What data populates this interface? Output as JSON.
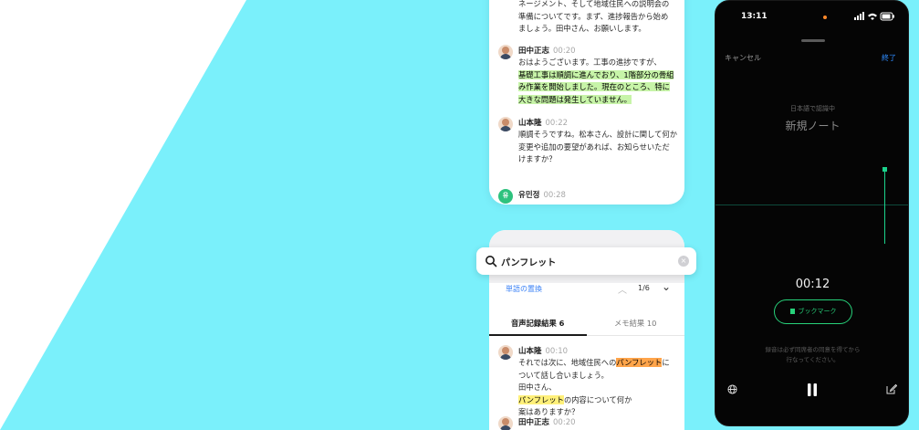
{
  "colors": {
    "accent_cyan": "#7af0fb",
    "highlight_green": "#c7f4a8",
    "highlight_orange": "#ffa44a",
    "highlight_yellow": "#fff07a",
    "record_green": "#27d17a",
    "link_blue": "#3b82f6"
  },
  "transcript": {
    "intro": {
      "lines": [
        "ネージメント、そして地域住民への説明会の",
        "準備についてです。まず、進捗報告から始め",
        "ましょう。田中さん、お願いします。"
      ]
    },
    "messages": [
      {
        "name": "田中正志",
        "time": "00:20",
        "lines": [
          {
            "text": "おはようございます。工事の進捗ですが、",
            "hl": ""
          },
          {
            "text": "基礎工事は順調に進んでおり、1階部分の骨組",
            "hl": "green"
          },
          {
            "text": "み作業を開始しました。現在のところ、特に",
            "hl": "green"
          },
          {
            "text": "大きな問題は発生していません。",
            "hl": "green"
          }
        ]
      },
      {
        "name": "山本隆",
        "time": "00:22",
        "lines": [
          {
            "text": "順調そうですね。松本さん、設計に関して何か",
            "hl": ""
          },
          {
            "text": "変更や追加の要望があれば、お知らせいただ",
            "hl": ""
          },
          {
            "text": "けますか？",
            "hl": ""
          }
        ]
      },
      {
        "name": "유민정",
        "time": "00:28",
        "avatar_letter": "유"
      }
    ]
  },
  "search": {
    "query": "パンフレット",
    "replace_label": "単語の置換",
    "count": "1/6",
    "tab_transcript": "音声記録結果 6",
    "tab_memo": "メモ結果 10",
    "result": {
      "name": "山本隆",
      "time": "00:10",
      "line1_a": "それでは次に、地域住民への",
      "line1_hl": "パンフレット",
      "line1_b": "に",
      "line2": "ついて話し合いましょう。",
      "line3": "田中さん、",
      "line4_hl": "パンフレット",
      "line4_b": "の内容について何か",
      "line5": "案はありますか？"
    },
    "next": {
      "name": "田中正志",
      "time": "00:20"
    }
  },
  "phone": {
    "status_time": "13:11",
    "cancel_label": "キャンセル",
    "done_label": "終了",
    "lang_status": "日本語で認識中",
    "note_title": "新規ノート",
    "timer": "00:12",
    "bookmark_label": "ブックマーク",
    "consent_line1": "録音は必ず同席者の同意を得てから",
    "consent_line2": "行なってください。",
    "icons": [
      "globe-icon",
      "pause-icon",
      "edit-icon"
    ]
  }
}
